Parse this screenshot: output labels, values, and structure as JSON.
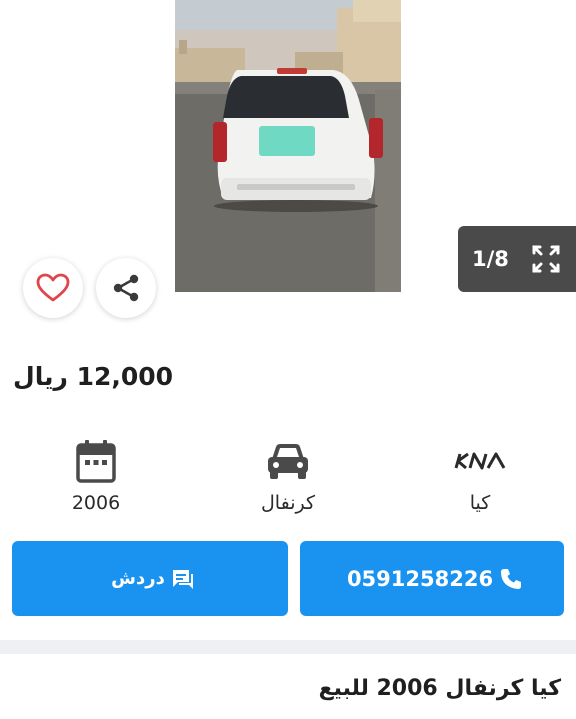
{
  "gallery": {
    "photo_subject": "white Kia Carnival minivan, rear view",
    "counter_label": "1/8",
    "prev_icon": "chevron-left-icon",
    "next_icon": "chevron-right-icon",
    "expand_icon": "expand-icon"
  },
  "actions": {
    "favorite_icon": "heart-icon",
    "share_icon": "share-icon",
    "accent_color": "#1a93f0",
    "heart_color": "#e0454b"
  },
  "listing": {
    "price": "12,000 ريال",
    "title": "كيا كرنفال 2006 للبيع"
  },
  "specs": [
    {
      "icon": "calendar-icon",
      "value": "2006"
    },
    {
      "icon": "car-icon",
      "value": "كرنفال"
    },
    {
      "icon": "kia-logo-icon",
      "value": "كيا"
    }
  ],
  "buttons": {
    "chat_label": "دردش",
    "chat_icon": "chat-icon",
    "call_label": "0591258226",
    "call_icon": "phone-icon"
  }
}
